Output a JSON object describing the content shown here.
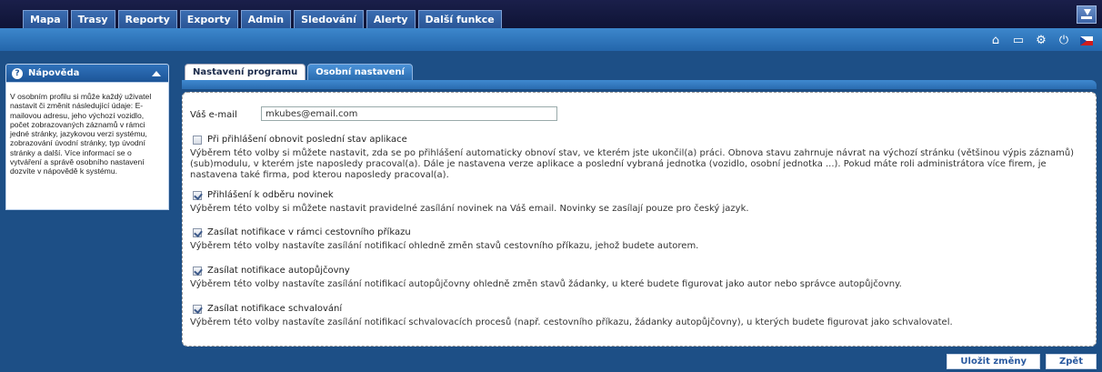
{
  "nav": {
    "tabs": [
      "Mapa",
      "Trasy",
      "Reporty",
      "Exporty",
      "Admin",
      "Sledování",
      "Alerty",
      "Další funkce"
    ]
  },
  "toolbar": {
    "icons": [
      "home-icon",
      "folder-icon",
      "settings-icon",
      "power-icon",
      "flag-cz-icon"
    ]
  },
  "help": {
    "title": "Nápověda",
    "text": "V osobním profilu si může každý uživatel nastavit či změnit následující údaje: E-mailovou adresu, jeho výchozí vozidlo, počet zobrazovaných záznamů v rámci jedné stránky, jazykovou verzi systému, zobrazování úvodní stránky, typ úvodní stránky a další. Více informací se o vytváření a správě osobního nastavení dozvíte v nápovědě k systému."
  },
  "tabs": {
    "program": "Nastavení programu",
    "personal": "Osobní nastavení"
  },
  "form": {
    "email_label": "Váš e-mail",
    "email_value": "mkubes@email.com",
    "options": [
      {
        "label": "Při přihlášení obnovit poslední stav aplikace",
        "checked": false,
        "desc": "Výběrem této volby si můžete nastavit, zda se po přihlášení automaticky obnoví stav, ve kterém jste ukončil(a) práci. Obnova stavu zahrnuje návrat na výchozí stránku (většinou výpis záznamů) (sub)modulu, v kterém jste naposledy pracoval(a). Dále je nastavena verze aplikace a poslední vybraná jednotka (vozidlo, osobní jednotka ...). Pokud máte roli administrátora více firem, je nastavena také firma, pod kterou naposledy pracoval(a)."
      },
      {
        "label": "Přihlášení k odběru novinek",
        "checked": true,
        "desc": "Výběrem této volby si můžete nastavit pravidelné zasílání novinek na Váš email. Novinky se zasílají pouze pro český jazyk."
      },
      {
        "label": "Zasílat notifikace v rámci cestovního příkazu",
        "checked": true,
        "desc": "Výběrem této volby nastavíte zasílání notifikací ohledně změn stavů cestovního příkazu, jehož budete autorem."
      },
      {
        "label": "Zasílat notifikace autopůjčovny",
        "checked": true,
        "desc": "Výběrem této volby nastavíte zasílání notifikací autopůjčovny ohledně změn stavů žádanky, u které budete figurovat jako autor nebo správce autopůjčovny."
      },
      {
        "label": "Zasílat notifikace schvalování",
        "checked": true,
        "desc": "Výběrem této volby nastavíte zasílání notifikací schvalovacích procesů (např. cestovního příkazu, žádanky autopůjčovny), u kterých budete figurovat jako schvalovatel."
      }
    ]
  },
  "buttons": {
    "save": "Uložit změny",
    "back": "Zpět"
  }
}
